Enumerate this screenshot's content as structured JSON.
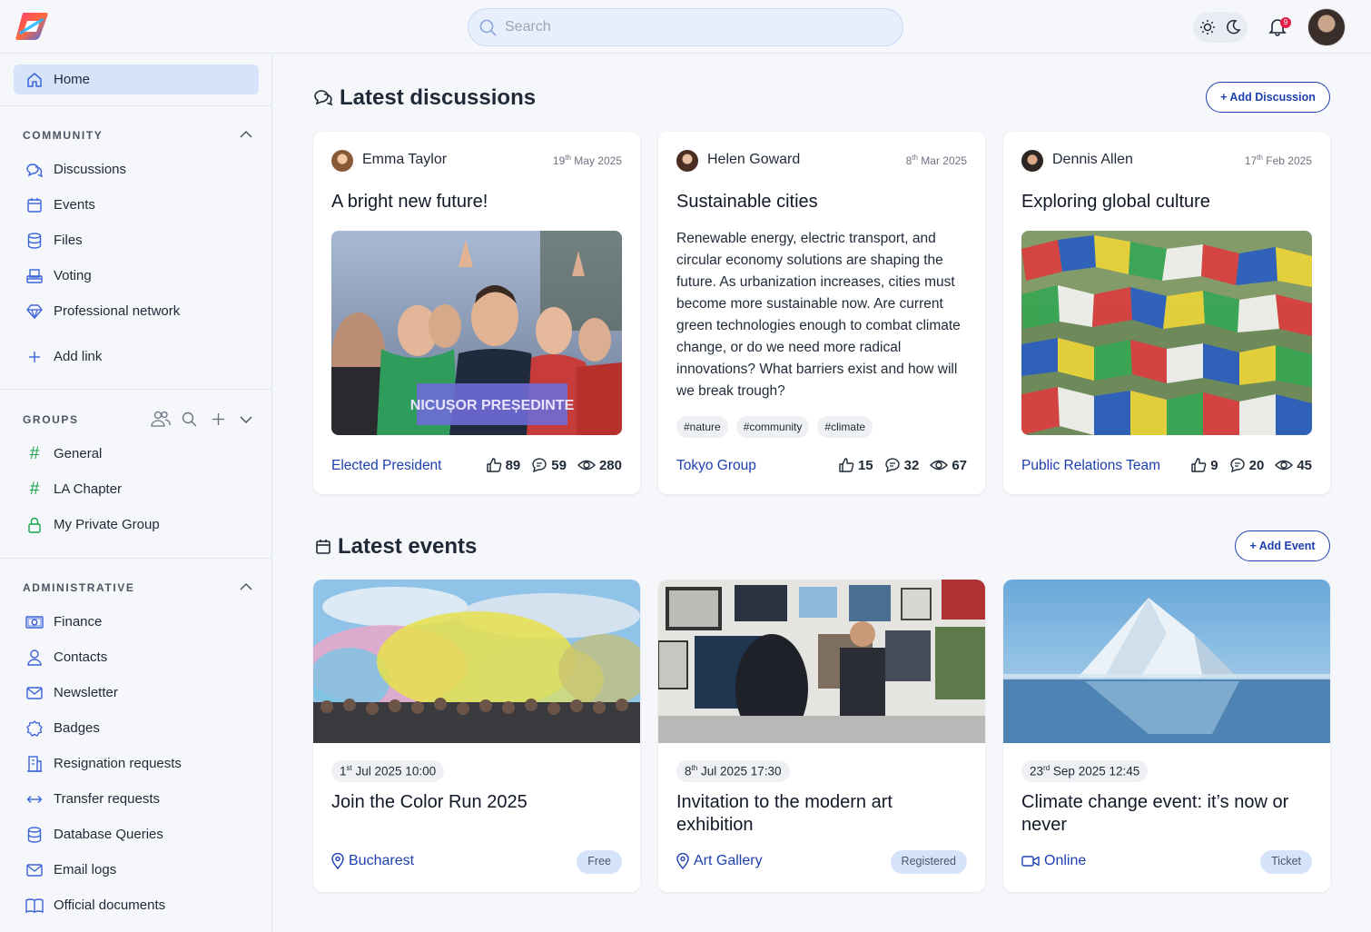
{
  "header": {
    "search_placeholder": "Search",
    "notification_count": "9"
  },
  "sidebar": {
    "home": "Home",
    "community": {
      "title": "COMMUNITY",
      "items": [
        "Discussions",
        "Events",
        "Files",
        "Voting",
        "Professional network"
      ],
      "add_link": "Add link"
    },
    "groups": {
      "title": "GROUPS",
      "items": [
        "General",
        "LA Chapter",
        "My Private Group"
      ]
    },
    "administrative": {
      "title": "ADMINISTRATIVE",
      "items": [
        "Finance",
        "Contacts",
        "Newsletter",
        "Badges",
        "Resignation requests",
        "Transfer requests",
        "Database Queries",
        "Email logs",
        "Official documents"
      ]
    }
  },
  "discussions": {
    "title": "Latest discussions",
    "add_label": "+ Add Discussion",
    "cards": [
      {
        "author": "Emma Taylor",
        "day": "19",
        "suffix": "th",
        "date_rest": "May 2025",
        "title": "A bright new future!",
        "image_caption": "NICUȘOR PREȘEDINTE",
        "group": "Elected President",
        "likes": "89",
        "comments": "59",
        "views": "280"
      },
      {
        "author": "Helen Goward",
        "day": "8",
        "suffix": "th",
        "date_rest": "Mar 2025",
        "title": "Sustainable cities",
        "body": "Renewable energy, electric transport, and circular economy solutions are shaping the future. As urbanization increases, cities must become more sustainable now. Are current green technologies enough to combat climate change, or do we need more radical innovations? What barriers exist and how will we break trough?",
        "tags": [
          "#nature",
          "#community",
          "#climate"
        ],
        "group": "Tokyo Group",
        "likes": "15",
        "comments": "32",
        "views": "67"
      },
      {
        "author": "Dennis Allen",
        "day": "17",
        "suffix": "th",
        "date_rest": "Feb 2025",
        "title": "Exploring global culture",
        "group": "Public Relations Team",
        "likes": "9",
        "comments": "20",
        "views": "45"
      }
    ]
  },
  "events": {
    "title": "Latest events",
    "add_label": "+ Add Event",
    "cards": [
      {
        "day": "1",
        "suffix": "st",
        "date_rest": "Jul 2025 10:00",
        "title": "Join the Color Run 2025",
        "location": "Bucharest",
        "badge": "Free"
      },
      {
        "day": "8",
        "suffix": "th",
        "date_rest": "Jul 2025 17:30",
        "title": "Invitation to the modern art exhibition",
        "location": "Art Gallery",
        "badge": "Registered"
      },
      {
        "day": "23",
        "suffix": "rd",
        "date_rest": "Sep 2025 12:45",
        "title": "Climate change event: it’s now or never",
        "location": "Online",
        "badge": "Ticket"
      }
    ]
  },
  "colors": {
    "accent": "#1e40af",
    "active_bg": "#d6e4fb",
    "icon_blue": "#3b63d9",
    "group_green": "#16a34a"
  }
}
